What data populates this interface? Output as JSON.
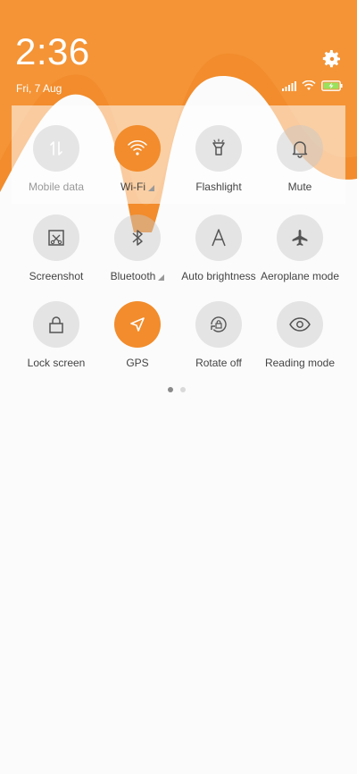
{
  "status_bar": {
    "time": "2:36",
    "date": "Fri, 7 Aug",
    "icons": [
      "signal-icon",
      "wifi-status-icon",
      "battery-charging-icon"
    ]
  },
  "accent_color": "#f28c2c",
  "tiles": [
    {
      "label": "Mobile data",
      "icon": "mobile-data-icon",
      "active": false,
      "dim": true
    },
    {
      "label": "Wi-Fi",
      "icon": "wifi-icon",
      "active": true,
      "expand": true
    },
    {
      "label": "Flashlight",
      "icon": "flashlight-icon",
      "active": false
    },
    {
      "label": "Mute",
      "icon": "bell-icon",
      "active": false
    },
    {
      "label": "Screenshot",
      "icon": "screenshot-icon",
      "active": false
    },
    {
      "label": "Bluetooth",
      "icon": "bluetooth-icon",
      "active": false,
      "expand": true
    },
    {
      "label": "Auto brightness",
      "icon": "auto-brightness-icon",
      "active": false
    },
    {
      "label": "Aeroplane mode",
      "icon": "airplane-icon",
      "active": false
    },
    {
      "label": "Lock screen",
      "icon": "lock-icon",
      "active": false
    },
    {
      "label": "GPS",
      "icon": "location-arrow-icon",
      "active": true
    },
    {
      "label": "Rotate off",
      "icon": "rotate-lock-icon",
      "active": false
    },
    {
      "label": "Reading mode",
      "icon": "eye-icon",
      "active": false
    }
  ],
  "pager": {
    "pages": 2,
    "current": 1
  }
}
